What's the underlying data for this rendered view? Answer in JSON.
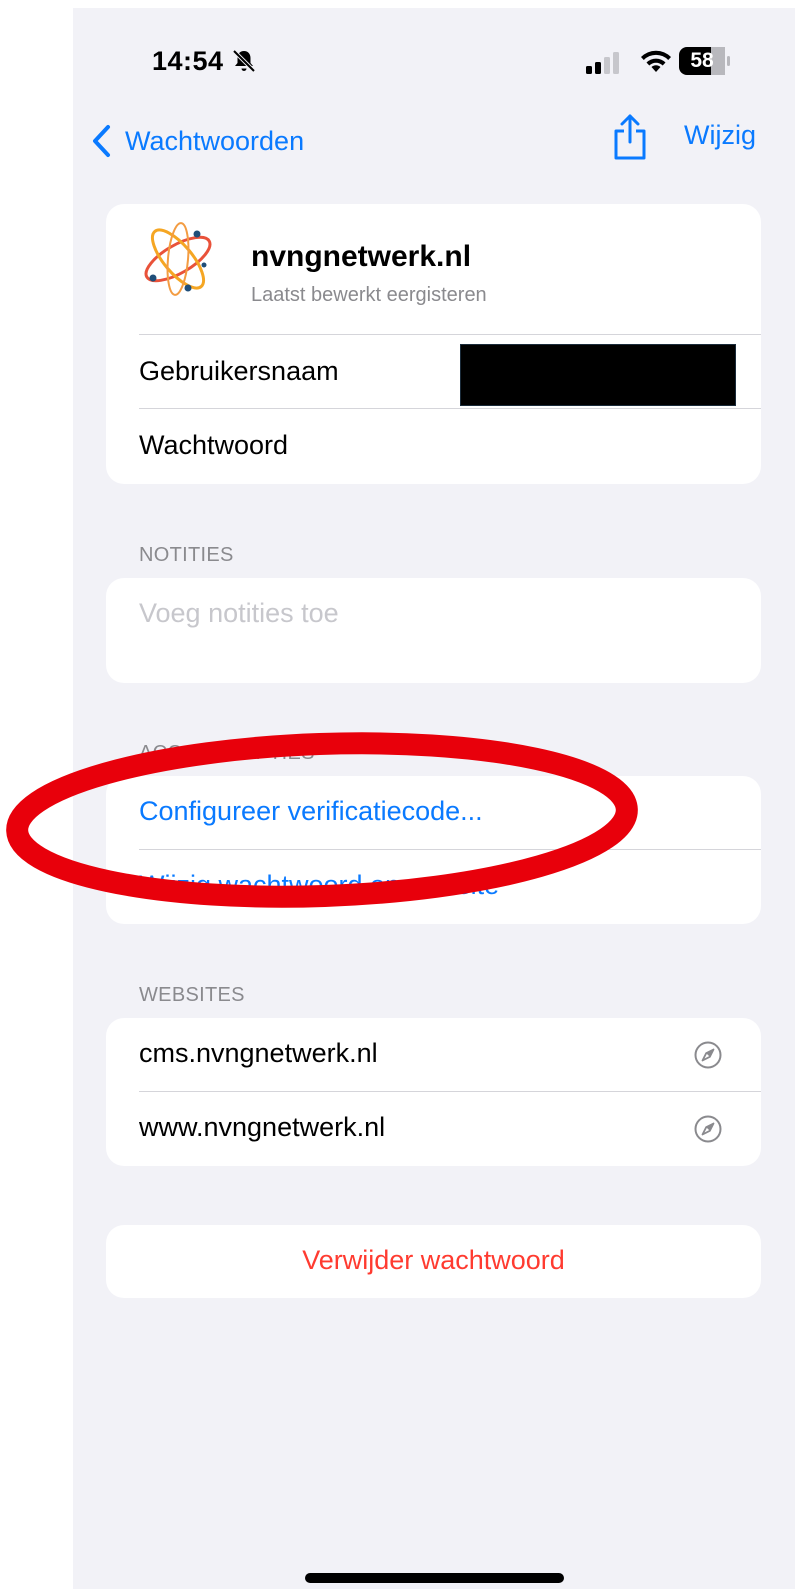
{
  "status_bar": {
    "time": "14:54",
    "battery_level": "58",
    "icons": [
      "bell-slash-icon",
      "signal-icon",
      "wifi-icon",
      "battery-icon"
    ]
  },
  "nav": {
    "back_label": "Wachtwoorden",
    "edit_label": "Wijzig",
    "share_icon": "share-icon"
  },
  "account": {
    "site_name": "nvngnetwerk.nl",
    "last_edited": "Laatst bewerkt eergisteren",
    "username_label": "Gebruikersnaam",
    "password_label": "Wachtwoord"
  },
  "notes": {
    "header": "NOTITIES",
    "placeholder": "Voeg notities toe"
  },
  "account_options": {
    "header": "ACCOUNTOPTIES",
    "items": [
      "Configureer verificatiecode...",
      "Wijzig wachtwoord op website"
    ]
  },
  "websites": {
    "header": "WEBSITES",
    "items": [
      "cms.nvngnetwerk.nl",
      "www.nvngnetwerk.nl"
    ]
  },
  "delete": {
    "label": "Verwijder wachtwoord"
  },
  "colors": {
    "accent": "#0a7aff",
    "destructive": "#ff3b30",
    "annotation": "#e8000b",
    "background": "#f2f2f7"
  }
}
